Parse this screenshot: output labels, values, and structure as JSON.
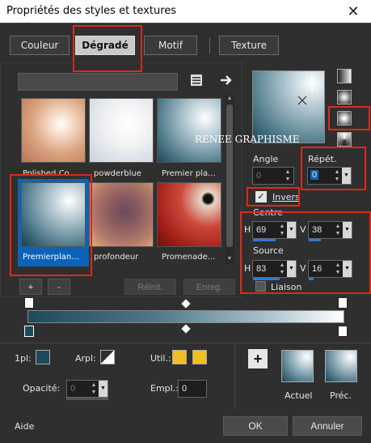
{
  "window": {
    "title": "Propriétés des styles et textures",
    "close": "✕"
  },
  "tabs": [
    "Couleur",
    "Dégradé",
    "Motif",
    "Texture"
  ],
  "gradients": [
    {
      "label": "Polished Co..."
    },
    {
      "label": "powderblue"
    },
    {
      "label": "Premier pla..."
    },
    {
      "label": "Premierplan..."
    },
    {
      "label": "profondeur"
    },
    {
      "label": "Promenade..."
    }
  ],
  "buttons": {
    "add": "+",
    "remove": "-",
    "reset": "Réinit.",
    "save": "Enreg."
  },
  "preview": {
    "watermark": "RENEE GRAPHISME"
  },
  "angle": {
    "label": "Angle",
    "value": "0"
  },
  "repeat": {
    "label": "Répét.",
    "value": "0"
  },
  "invert": {
    "label": "Invers",
    "checked": "✓"
  },
  "center": {
    "label": "Centre",
    "h_label": "H",
    "h_value": "69",
    "v_label": "V",
    "v_value": "38",
    "h_fill": 0.69,
    "v_fill": 0.38
  },
  "source": {
    "label": "Source",
    "h_label": "H",
    "h_value": "83",
    "v_label": "V",
    "v_value": "16",
    "h_fill": 0.83,
    "v_fill": 0.16
  },
  "link": {
    "label": "Liaison"
  },
  "bottom": {
    "layer_label": "1pl:",
    "arpl_label": "Arpl:",
    "util_label": "Util.:",
    "opacity_label": "Opacité:",
    "opacity_value": "0",
    "empl_label": "Empl.:",
    "empl_value": "0",
    "current_label": "Actuel",
    "previous_label": "Préc.",
    "plus": "+"
  },
  "footer": {
    "help": "Aide",
    "ok": "OK",
    "cancel": "Annuler"
  },
  "colors": {
    "accent": "#2f7ad6",
    "highlight": "#e0281a",
    "swatch_yellow": "#f0c020"
  }
}
